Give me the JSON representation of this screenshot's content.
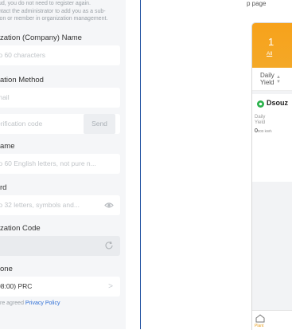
{
  "notice": {
    "line1": "ud, you do not need to register again.",
    "line2": "ntact the administrator to add you as a sub-",
    "line3": "ion or member in organization management."
  },
  "form": {
    "org_name_label": "zation (Company) Name",
    "org_name_placeholder": "to 60 characters",
    "verification_method_label": "ation Method",
    "email_placeholder": "mail",
    "verification_code_placeholder": "erification code",
    "send_label": "Send",
    "username_label": "ame",
    "username_placeholder": "to 60 English letters, not pure n...",
    "password_label": "rd",
    "password_placeholder": "to 32 letters, symbols and...",
    "org_code_label": "zation Code",
    "org_code_value": ")",
    "timezone_label": "one",
    "timezone_value": "08:00) PRC",
    "policy_prefix": "re agreed",
    "policy_link": "Privacy Policy"
  },
  "app": {
    "top_text": "p page",
    "plant_count": "1",
    "count_label": "All",
    "sort_label_line1": "Daily",
    "sort_label_line2": "Yield",
    "plant_name": "Dsouz",
    "daily_yield_label_line1": "Daily",
    "daily_yield_label_line2": "Yield",
    "daily_yield_value": "0",
    "daily_yield_unit": "000 kWh",
    "tab_plant_label": "Plant"
  },
  "colors": {
    "accent_orange": "#f7a21b",
    "status_green": "#2bb24c",
    "link_blue": "#2f6fd6",
    "divider_blue": "#1d4fa0"
  }
}
